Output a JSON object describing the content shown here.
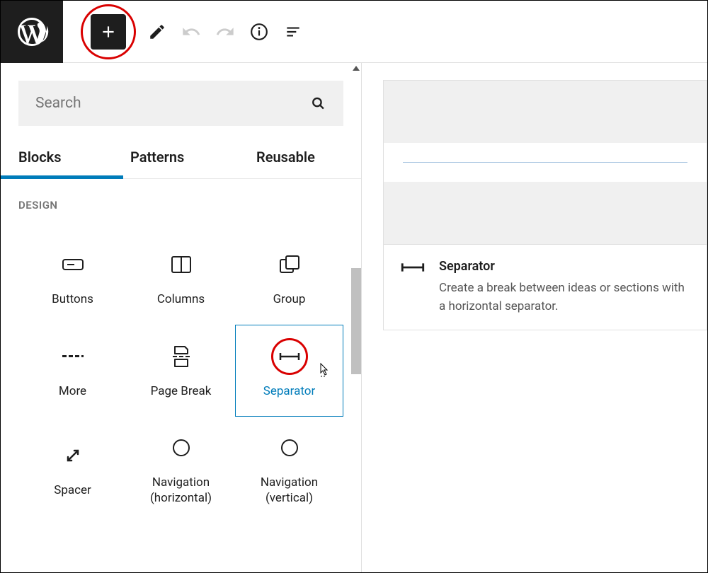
{
  "search": {
    "placeholder": "Search"
  },
  "tabs": {
    "blocks": "Blocks",
    "patterns": "Patterns",
    "reusable": "Reusable"
  },
  "section": {
    "design": "DESIGN"
  },
  "blocks": {
    "buttons": "Buttons",
    "columns": "Columns",
    "group": "Group",
    "more": "More",
    "pagebreak": "Page Break",
    "separator": "Separator",
    "spacer": "Spacer",
    "navh": "Navigation (horizontal)",
    "navv": "Navigation (vertical)"
  },
  "info": {
    "title": "Separator",
    "desc": "Create a break between ideas or sections with a horizontal separator."
  }
}
